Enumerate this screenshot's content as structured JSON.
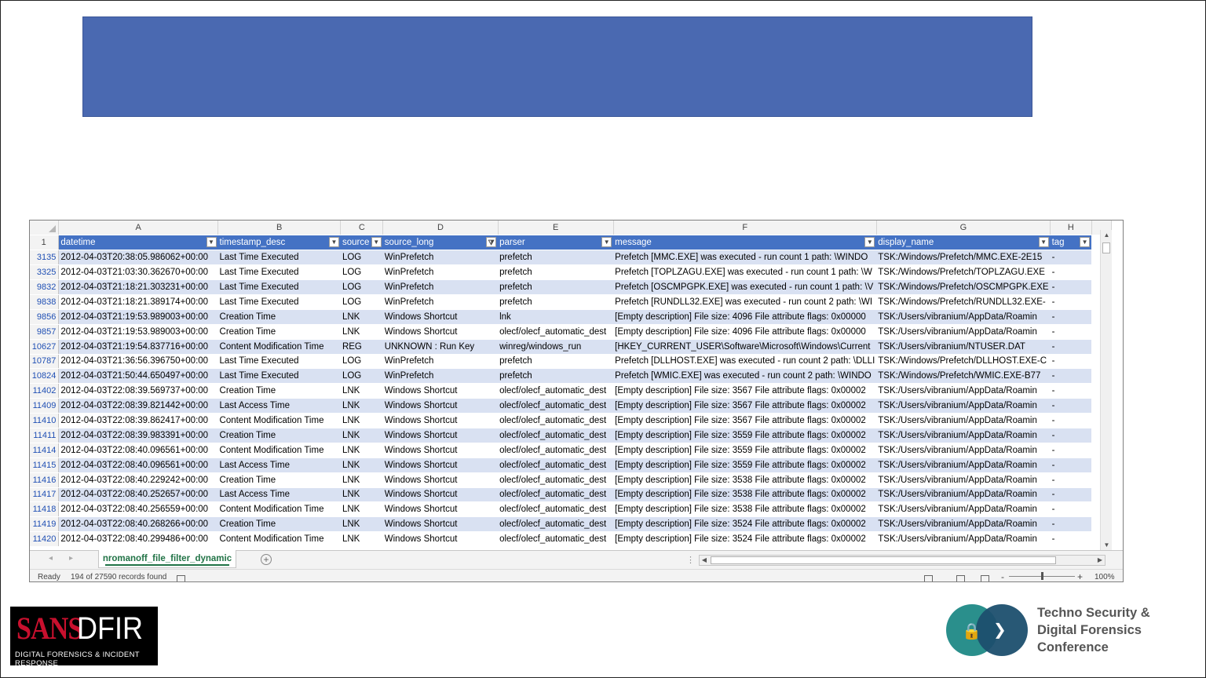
{
  "excel": {
    "corner_row_label": "1",
    "columns": [
      {
        "letter": "A",
        "field": "datetime"
      },
      {
        "letter": "B",
        "field": "timestamp_desc"
      },
      {
        "letter": "C",
        "field": "source"
      },
      {
        "letter": "D",
        "field": "source_long",
        "filtered": true
      },
      {
        "letter": "E",
        "field": "parser"
      },
      {
        "letter": "F",
        "field": "message"
      },
      {
        "letter": "G",
        "field": "display_name"
      },
      {
        "letter": "H",
        "field": "tag"
      }
    ],
    "rows": [
      {
        "n": "3135",
        "cells": [
          "2012-04-03T20:38:05.986062+00:00",
          "Last Time Executed",
          "LOG",
          "WinPrefetch",
          "prefetch",
          "Prefetch [MMC.EXE] was executed - run count 1 path: \\WINDO",
          "TSK:/Windows/Prefetch/MMC.EXE-2E15",
          "-"
        ]
      },
      {
        "n": "3325",
        "cells": [
          "2012-04-03T21:03:30.362670+00:00",
          "Last Time Executed",
          "LOG",
          "WinPrefetch",
          "prefetch",
          "Prefetch [TOPLZAGU.EXE] was executed - run count 1 path: \\W",
          "TSK:/Windows/Prefetch/TOPLZAGU.EXE",
          "-"
        ]
      },
      {
        "n": "9832",
        "cells": [
          "2012-04-03T21:18:21.303231+00:00",
          "Last Time Executed",
          "LOG",
          "WinPrefetch",
          "prefetch",
          "Prefetch [OSCMPGPK.EXE] was executed - run count 1 path: \\V",
          "TSK:/Windows/Prefetch/OSCMPGPK.EXE",
          "-"
        ]
      },
      {
        "n": "9838",
        "cells": [
          "2012-04-03T21:18:21.389174+00:00",
          "Last Time Executed",
          "LOG",
          "WinPrefetch",
          "prefetch",
          "Prefetch [RUNDLL32.EXE] was executed - run count 2 path: \\WI",
          "TSK:/Windows/Prefetch/RUNDLL32.EXE-",
          "-"
        ]
      },
      {
        "n": "9856",
        "cells": [
          "2012-04-03T21:19:53.989003+00:00",
          "Creation Time",
          "LNK",
          "Windows Shortcut",
          "lnk",
          "[Empty description] File size: 4096 File attribute flags: 0x00000",
          "TSK:/Users/vibranium/AppData/Roamin",
          "-"
        ]
      },
      {
        "n": "9857",
        "cells": [
          "2012-04-03T21:19:53.989003+00:00",
          "Creation Time",
          "LNK",
          "Windows Shortcut",
          "olecf/olecf_automatic_dest",
          "[Empty description] File size: 4096 File attribute flags: 0x00000",
          "TSK:/Users/vibranium/AppData/Roamin",
          "-"
        ]
      },
      {
        "n": "10627",
        "cells": [
          "2012-04-03T21:19:54.837716+00:00",
          "Content Modification Time",
          "REG",
          "UNKNOWN : Run Key",
          "winreg/windows_run",
          "[HKEY_CURRENT_USER\\Software\\Microsoft\\Windows\\Current",
          "TSK:/Users/vibranium/NTUSER.DAT",
          "-"
        ]
      },
      {
        "n": "10787",
        "cells": [
          "2012-04-03T21:36:56.396750+00:00",
          "Last Time Executed",
          "LOG",
          "WinPrefetch",
          "prefetch",
          "Prefetch [DLLHOST.EXE] was executed - run count 2 path: \\DLLI",
          "TSK:/Windows/Prefetch/DLLHOST.EXE-C",
          "-"
        ]
      },
      {
        "n": "10824",
        "cells": [
          "2012-04-03T21:50:44.650497+00:00",
          "Last Time Executed",
          "LOG",
          "WinPrefetch",
          "prefetch",
          "Prefetch [WMIC.EXE] was executed - run count 2 path: \\WINDO",
          "TSK:/Windows/Prefetch/WMIC.EXE-B77",
          "-"
        ]
      },
      {
        "n": "11402",
        "cells": [
          "2012-04-03T22:08:39.569737+00:00",
          "Creation Time",
          "LNK",
          "Windows Shortcut",
          "olecf/olecf_automatic_dest",
          "[Empty description] File size: 3567 File attribute flags: 0x00002",
          "TSK:/Users/vibranium/AppData/Roamin",
          "-"
        ]
      },
      {
        "n": "11409",
        "cells": [
          "2012-04-03T22:08:39.821442+00:00",
          "Last Access Time",
          "LNK",
          "Windows Shortcut",
          "olecf/olecf_automatic_dest",
          "[Empty description] File size: 3567 File attribute flags: 0x00002",
          "TSK:/Users/vibranium/AppData/Roamin",
          "-"
        ]
      },
      {
        "n": "11410",
        "cells": [
          "2012-04-03T22:08:39.862417+00:00",
          "Content Modification Time",
          "LNK",
          "Windows Shortcut",
          "olecf/olecf_automatic_dest",
          "[Empty description] File size: 3567 File attribute flags: 0x00002",
          "TSK:/Users/vibranium/AppData/Roamin",
          "-"
        ]
      },
      {
        "n": "11411",
        "cells": [
          "2012-04-03T22:08:39.983391+00:00",
          "Creation Time",
          "LNK",
          "Windows Shortcut",
          "olecf/olecf_automatic_dest",
          "[Empty description] File size: 3559 File attribute flags: 0x00002",
          "TSK:/Users/vibranium/AppData/Roamin",
          "-"
        ]
      },
      {
        "n": "11414",
        "cells": [
          "2012-04-03T22:08:40.096561+00:00",
          "Content Modification Time",
          "LNK",
          "Windows Shortcut",
          "olecf/olecf_automatic_dest",
          "[Empty description] File size: 3559 File attribute flags: 0x00002",
          "TSK:/Users/vibranium/AppData/Roamin",
          "-"
        ]
      },
      {
        "n": "11415",
        "cells": [
          "2012-04-03T22:08:40.096561+00:00",
          "Last Access Time",
          "LNK",
          "Windows Shortcut",
          "olecf/olecf_automatic_dest",
          "[Empty description] File size: 3559 File attribute flags: 0x00002",
          "TSK:/Users/vibranium/AppData/Roamin",
          "-"
        ]
      },
      {
        "n": "11416",
        "cells": [
          "2012-04-03T22:08:40.229242+00:00",
          "Creation Time",
          "LNK",
          "Windows Shortcut",
          "olecf/olecf_automatic_dest",
          "[Empty description] File size: 3538 File attribute flags: 0x00002",
          "TSK:/Users/vibranium/AppData/Roamin",
          "-"
        ]
      },
      {
        "n": "11417",
        "cells": [
          "2012-04-03T22:08:40.252657+00:00",
          "Last Access Time",
          "LNK",
          "Windows Shortcut",
          "olecf/olecf_automatic_dest",
          "[Empty description] File size: 3538 File attribute flags: 0x00002",
          "TSK:/Users/vibranium/AppData/Roamin",
          "-"
        ]
      },
      {
        "n": "11418",
        "cells": [
          "2012-04-03T22:08:40.256559+00:00",
          "Content Modification Time",
          "LNK",
          "Windows Shortcut",
          "olecf/olecf_automatic_dest",
          "[Empty description] File size: 3538 File attribute flags: 0x00002",
          "TSK:/Users/vibranium/AppData/Roamin",
          "-"
        ]
      },
      {
        "n": "11419",
        "cells": [
          "2012-04-03T22:08:40.268266+00:00",
          "Creation Time",
          "LNK",
          "Windows Shortcut",
          "olecf/olecf_automatic_dest",
          "[Empty description] File size: 3524 File attribute flags: 0x00002",
          "TSK:/Users/vibranium/AppData/Roamin",
          "-"
        ]
      },
      {
        "n": "11420",
        "cells": [
          "2012-04-03T22:08:40.299486+00:00",
          "Content Modification Time",
          "LNK",
          "Windows Shortcut",
          "olecf/olecf_automatic_dest",
          "[Empty description] File size: 3524 File attribute flags: 0x00002",
          "TSK:/Users/vibranium/AppData/Roamin",
          "-"
        ]
      }
    ],
    "sheet_tab": "nromanoff_file_filter_dynamic",
    "status": {
      "ready": "Ready",
      "records": "194 of 27590 records found",
      "zoom_minus": "-",
      "zoom_plus": "+",
      "zoom": "100%"
    }
  },
  "logos": {
    "sans": {
      "word1": "SANS",
      "word2": "DFIR",
      "tagline": "DIGITAL FORENSICS & INCIDENT RESPONSE"
    },
    "techno": {
      "line1": "Techno Security &",
      "line2": "Digital Forensics",
      "line3": "Conference"
    }
  },
  "colors": {
    "title_box": "#4a69b1",
    "table_header": "#4472c4",
    "band": "#d9e1f2",
    "sheet_tab_accent": "#217346"
  }
}
